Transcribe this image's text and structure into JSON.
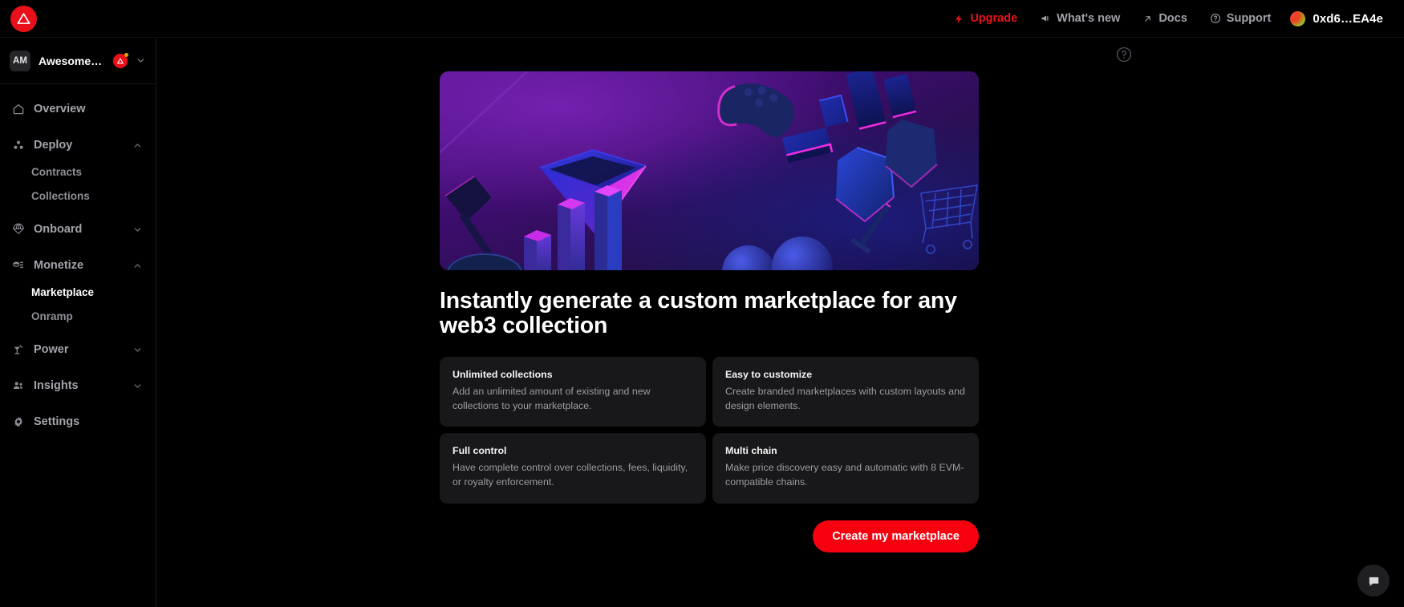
{
  "topbar": {
    "logo_icon": "thirdweb-logo-icon",
    "nav": [
      {
        "label": "Upgrade",
        "icon": "lightning-bolt-icon",
        "accent": true
      },
      {
        "label": "What's new",
        "icon": "megaphone-icon",
        "accent": false
      },
      {
        "label": "Docs",
        "icon": "arrow-up-right-icon",
        "accent": false
      },
      {
        "label": "Support",
        "icon": "question-circle-icon",
        "accent": false
      }
    ],
    "wallet": {
      "address": "0xd6…EA4e",
      "avatar_icon": "wallet-avatar-icon"
    }
  },
  "sidebar": {
    "team": {
      "initials": "AM",
      "name": "Awesome m…",
      "mark_icon": "thirdweb-mark-icon",
      "caret_icon": "chevron-down-icon"
    },
    "items": [
      {
        "label": "Overview",
        "icon": "home-icon",
        "expandable": false,
        "active": false
      },
      {
        "label": "Deploy",
        "icon": "deploy-dots-icon",
        "expandable": true,
        "expanded": true,
        "caret_icon": "chevron-up-icon",
        "children": [
          {
            "label": "Contracts",
            "active": false
          },
          {
            "label": "Collections",
            "active": false
          }
        ]
      },
      {
        "label": "Onboard",
        "icon": "parachute-icon",
        "expandable": true,
        "expanded": false,
        "caret_icon": "chevron-down-icon",
        "children": []
      },
      {
        "label": "Monetize",
        "icon": "coins-icon",
        "expandable": true,
        "expanded": true,
        "caret_icon": "chevron-up-icon",
        "children": [
          {
            "label": "Marketplace",
            "active": true
          },
          {
            "label": "Onramp",
            "active": false
          }
        ]
      },
      {
        "label": "Power",
        "icon": "power-icon",
        "expandable": true,
        "expanded": false,
        "caret_icon": "chevron-down-icon",
        "children": []
      },
      {
        "label": "Insights",
        "icon": "users-icon",
        "expandable": true,
        "expanded": false,
        "caret_icon": "chevron-down-icon",
        "children": []
      },
      {
        "label": "Settings",
        "icon": "gear-icon",
        "expandable": false,
        "active": false
      }
    ]
  },
  "main": {
    "help_icon": "question-circle-icon",
    "hero_image_alt": "3d-neon-web3-objects-banner",
    "headline": "Instantly generate a custom marketplace for any web3 collection",
    "cards": [
      {
        "title": "Unlimited collections",
        "desc": "Add an unlimited amount of existing and new collections to your marketplace."
      },
      {
        "title": "Easy to customize",
        "desc": "Create branded marketplaces with custom layouts and design elements."
      },
      {
        "title": "Full control",
        "desc": "Have complete control over collections, fees, liquidity, or royalty enforcement."
      },
      {
        "title": "Multi chain",
        "desc": "Make price discovery easy and automatic with 8 EVM-compatible chains."
      }
    ],
    "cta_label": "Create my marketplace",
    "chat_icon": "chat-bubble-icon"
  },
  "colors": {
    "brand_red": "#E8111A",
    "cta_red": "#F6000F",
    "page_bg": "#000000",
    "card_bg": "#18181A",
    "muted_text": "#9B9BA3",
    "hero_purple": "#3A0C63",
    "hero_magenta": "#E028D8",
    "hero_blue": "#2B3AE0"
  }
}
